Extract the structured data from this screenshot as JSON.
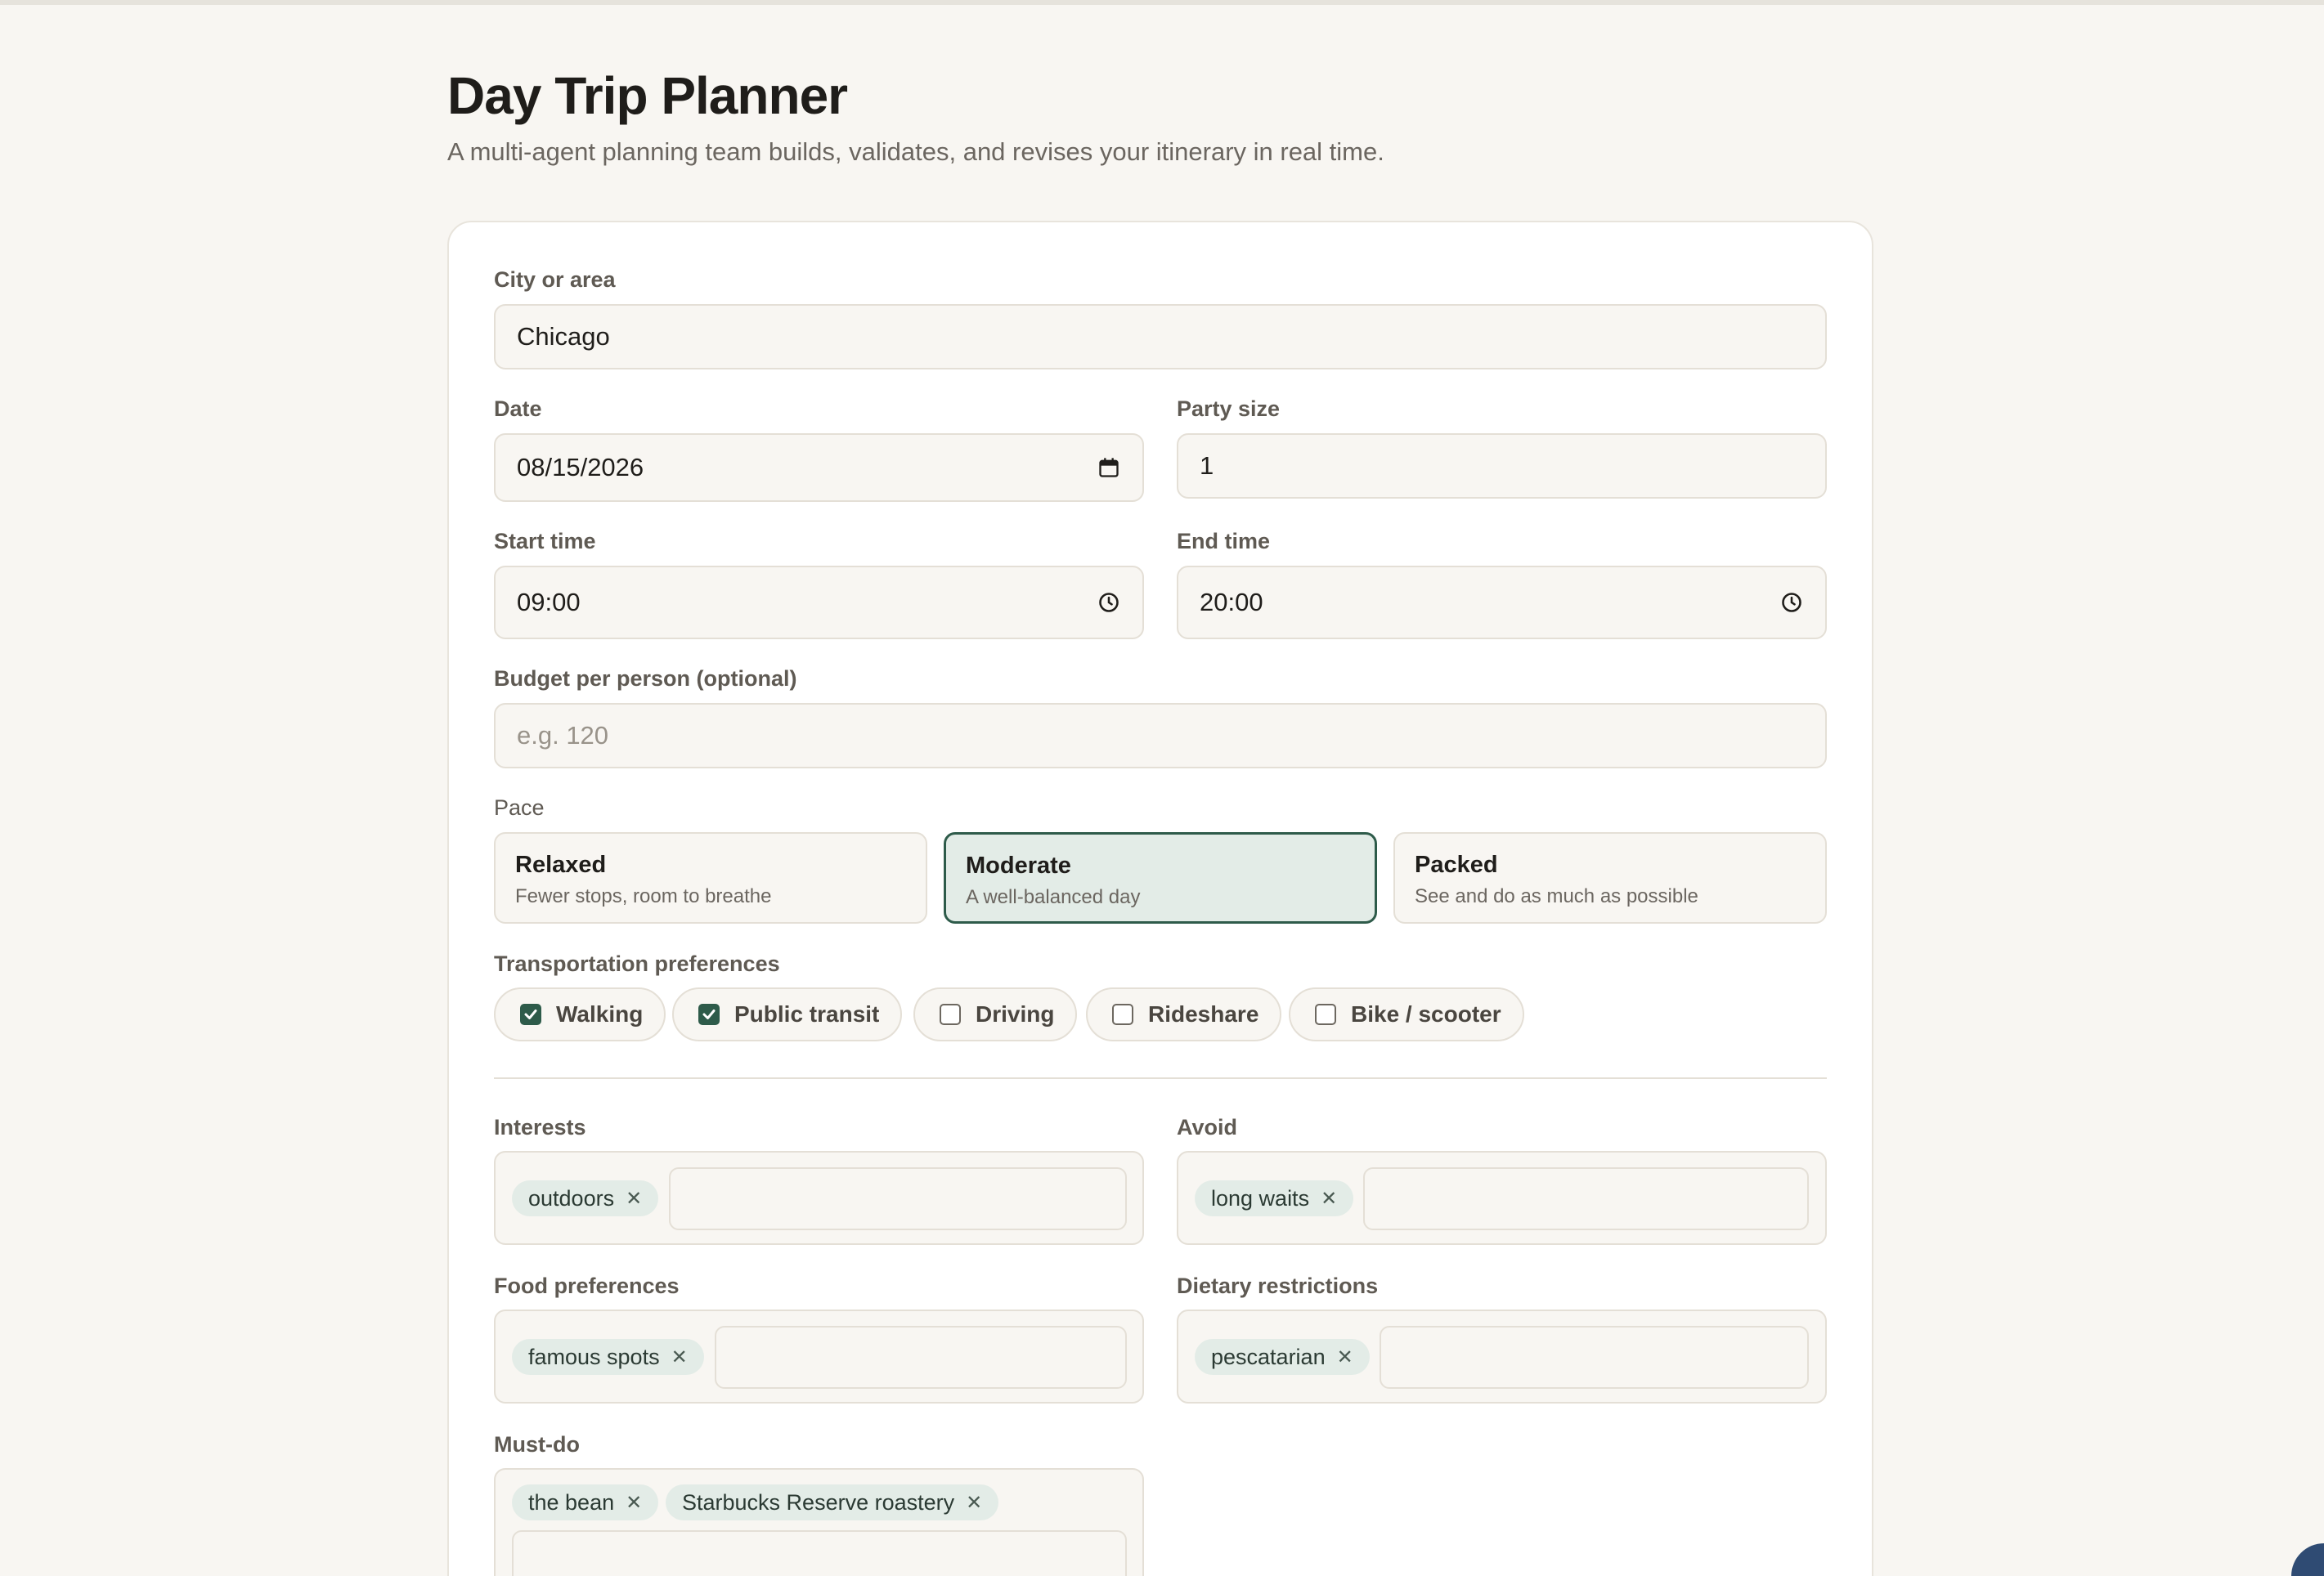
{
  "header": {
    "title": "Day Trip Planner",
    "subtitle": "A multi-agent planning team builds, validates, and revises your itinerary in real time."
  },
  "form": {
    "city": {
      "label": "City or area",
      "value": "Chicago"
    },
    "date": {
      "label": "Date",
      "value": "08/15/2026"
    },
    "party_size": {
      "label": "Party size",
      "value": "1"
    },
    "start_time": {
      "label": "Start time",
      "value": "09:00"
    },
    "end_time": {
      "label": "End time",
      "value": "20:00"
    },
    "budget": {
      "label": "Budget per person (optional)",
      "value": "",
      "placeholder": "e.g. 120"
    },
    "pace": {
      "label": "Pace",
      "selected": "Moderate",
      "options": [
        {
          "title": "Relaxed",
          "desc": "Fewer stops, room to breathe"
        },
        {
          "title": "Moderate",
          "desc": "A well-balanced day"
        },
        {
          "title": "Packed",
          "desc": "See and do as much as possible"
        }
      ]
    },
    "transport": {
      "label": "Transportation preferences",
      "options": [
        {
          "label": "Walking",
          "checked": true
        },
        {
          "label": "Public transit",
          "checked": true
        },
        {
          "label": "Driving",
          "checked": false
        },
        {
          "label": "Rideshare",
          "checked": false
        },
        {
          "label": "Bike / scooter",
          "checked": false
        }
      ]
    },
    "interests": {
      "label": "Interests",
      "tags": [
        "outdoors"
      ]
    },
    "avoid": {
      "label": "Avoid",
      "tags": [
        "long waits"
      ]
    },
    "food": {
      "label": "Food preferences",
      "tags": [
        "famous spots"
      ]
    },
    "dietary": {
      "label": "Dietary restrictions",
      "tags": [
        "pescatarian"
      ]
    },
    "must_do": {
      "label": "Must-do",
      "tags": [
        "the bean",
        "Starbucks Reserve roastery"
      ]
    }
  },
  "colors": {
    "background": "#f8f6f2",
    "accent": "#2e5b4a",
    "tag_bg": "#e3ece7"
  },
  "icons": {
    "calendar": "calendar-icon",
    "clock": "clock-icon",
    "remove": "close-icon",
    "check": "checkmark-icon"
  }
}
